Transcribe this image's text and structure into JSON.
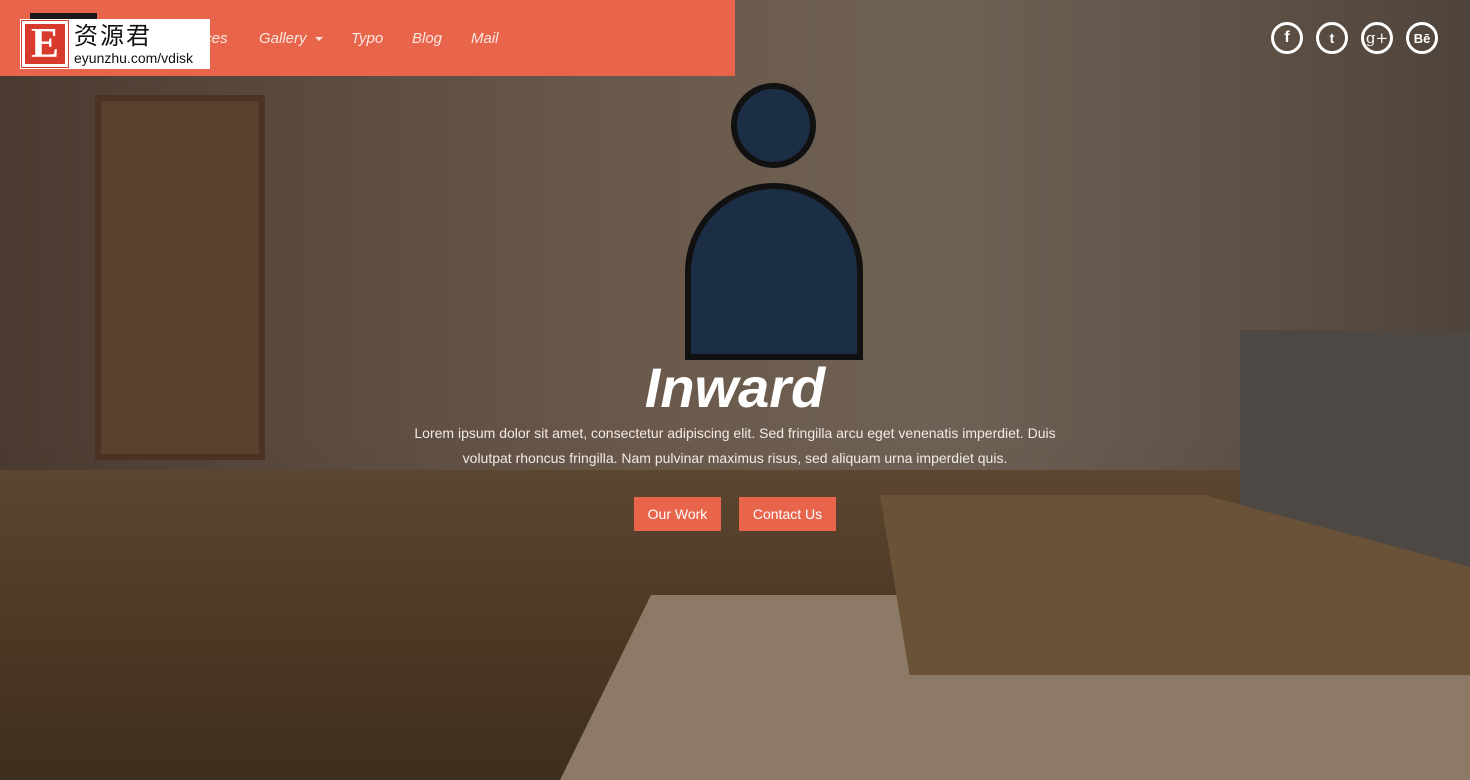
{
  "nav": {
    "items": [
      {
        "label": "Services"
      },
      {
        "label": "Gallery",
        "has_dropdown": true
      },
      {
        "label": "Typo"
      },
      {
        "label": "Blog"
      },
      {
        "label": "Mail"
      }
    ],
    "color": "#e8654c"
  },
  "watermark": {
    "letter": "E",
    "chinese": "资源君",
    "url": "eyunzhu.com/vdisk"
  },
  "social": [
    {
      "icon": "facebook-icon",
      "glyph": "f"
    },
    {
      "icon": "twitter-icon",
      "glyph": "t"
    },
    {
      "icon": "google-plus-icon",
      "glyph": "g+"
    },
    {
      "icon": "behance-icon",
      "glyph": "Bē"
    }
  ],
  "hero": {
    "title": "Inward",
    "text": "Lorem ipsum dolor sit amet, consectetur adipiscing elit. Sed fringilla arcu eget venenatis imperdiet. Duis volutpat rhoncus fringilla. Nam pulvinar maximus risus, sed aliquam urna imperdiet quis.",
    "buttons": [
      {
        "label": "Our Work"
      },
      {
        "label": "Contact Us"
      }
    ]
  }
}
